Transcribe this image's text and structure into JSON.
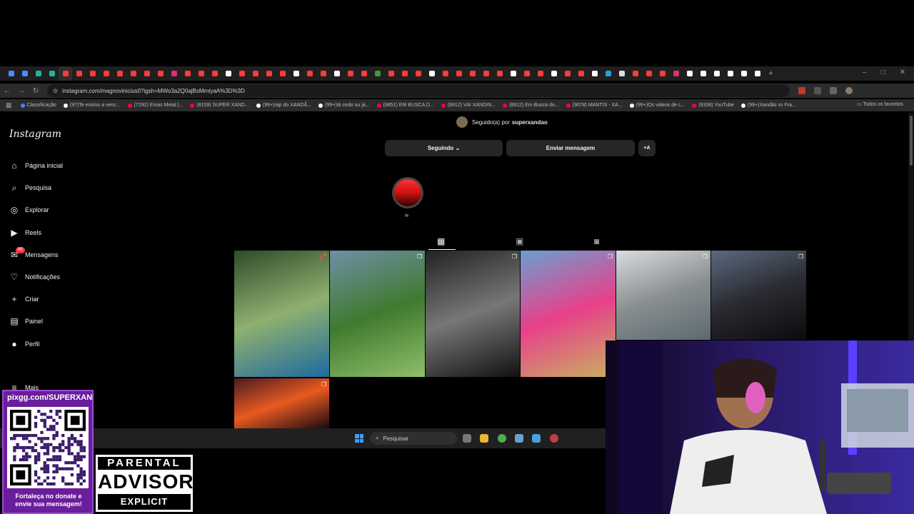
{
  "browser": {
    "url": "instagram.com/magnovinicius0?igsh=MWo3a2Q0ajBsMmtyaA%3D%3D",
    "bookmarks": [
      {
        "label": "Classificação",
        "color": "#4285f4"
      },
      {
        "label": "(97)Te ensino a venc...",
        "color": "#ffffff"
      },
      {
        "label": "(7292) Ervas Metal |...",
        "color": "#ff0033"
      },
      {
        "label": "(8159) SUPER XAND...",
        "color": "#ff0033"
      },
      {
        "label": "(99+)rap do XANDÃ...",
        "color": "#ffffff"
      },
      {
        "label": "(99+)tá cedo ou já...",
        "color": "#ffffff"
      },
      {
        "label": "(8851) EM BUSCA D...",
        "color": "#ff0033"
      },
      {
        "label": "(8912) VAI XANDIN...",
        "color": "#ff0033"
      },
      {
        "label": "(8912) Em Busca do...",
        "color": "#ff0033"
      },
      {
        "label": "(9078) MANTIS - XA...",
        "color": "#ff0033"
      },
      {
        "label": "(99+)Os videos de c...",
        "color": "#ffffff"
      },
      {
        "label": "(9338) YouTube",
        "color": "#ff0033"
      },
      {
        "label": "(99+)Xandão vs Fra...",
        "color": "#ffffff"
      }
    ],
    "all_bookmarks_label": "Todos os favoritos",
    "window_controls": [
      "–",
      "□",
      "✕"
    ]
  },
  "instagram": {
    "logo": "Instagram",
    "nav": [
      {
        "label": "Página inicial",
        "icon": "home-icon",
        "glyph": "⌂"
      },
      {
        "label": "Pesquisa",
        "icon": "search-icon",
        "glyph": "⌕"
      },
      {
        "label": "Explorar",
        "icon": "compass-icon",
        "glyph": "◎"
      },
      {
        "label": "Reels",
        "icon": "reels-icon",
        "glyph": "▶"
      },
      {
        "label": "Mensagens",
        "icon": "messenger-icon",
        "glyph": "✉"
      },
      {
        "label": "Notificações",
        "icon": "heart-icon",
        "glyph": "♡"
      },
      {
        "label": "Criar",
        "icon": "plus-icon",
        "glyph": "+"
      },
      {
        "label": "Painel",
        "icon": "dashboard-icon",
        "glyph": "▤"
      },
      {
        "label": "Perfil",
        "icon": "profile-icon",
        "glyph": "●"
      },
      {
        "label": "Mais",
        "icon": "menu-icon",
        "glyph": "≡"
      }
    ],
    "messages_badge": "99",
    "followed_by_prefix": "Seguido(a) por",
    "followed_by_user": "superxandao",
    "following_button": "Seguindo ⌄",
    "message_button": "Enviar mensagem",
    "add_person_button": "+A",
    "story_label": "✉",
    "profile_tabs": [
      "grid-icon",
      "reels-icon",
      "tagged-icon"
    ],
    "posts": [
      {
        "desc": "couple-photo",
        "colors": [
          "#2f4a2a",
          "#8fb06f",
          "#1e6aa0"
        ],
        "pinned": true
      },
      {
        "desc": "soccer-players",
        "colors": [
          "#6f8fa6",
          "#3f7a2f",
          "#8fbf6a"
        ],
        "pinned": false
      },
      {
        "desc": "gym-black-white",
        "colors": [
          "#222222",
          "#777777",
          "#111111"
        ],
        "pinned": false
      },
      {
        "desc": "runner-pink-shirt",
        "colors": [
          "#6aa0d0",
          "#e8408a",
          "#c8b060"
        ],
        "pinned": false
      },
      {
        "desc": "doctor-office",
        "colors": [
          "#d8dde0",
          "#8a8f90",
          "#5a6a70"
        ],
        "pinned": false
      },
      {
        "desc": "night-crowd",
        "colors": [
          "#5a6a80",
          "#2a2a30",
          "#0a0a0f"
        ],
        "pinned": false
      },
      {
        "desc": "sunset-sky",
        "colors": [
          "#4a1a20",
          "#e85a20",
          "#1a0a10"
        ],
        "pinned": false
      }
    ]
  },
  "taskbar": {
    "search_placeholder": "Pesquisar"
  },
  "overlays": {
    "qr_url": "pixgg.com/SUPERXANDÃO",
    "qr_cta_line1": "Fortaleça no donate e",
    "qr_cta_line2": "envie sua mensagem!",
    "advisory_top": "PARENTAL",
    "advisory_mid": "ADVISORY",
    "advisory_bottom": "EXPLICIT CONTENT"
  }
}
